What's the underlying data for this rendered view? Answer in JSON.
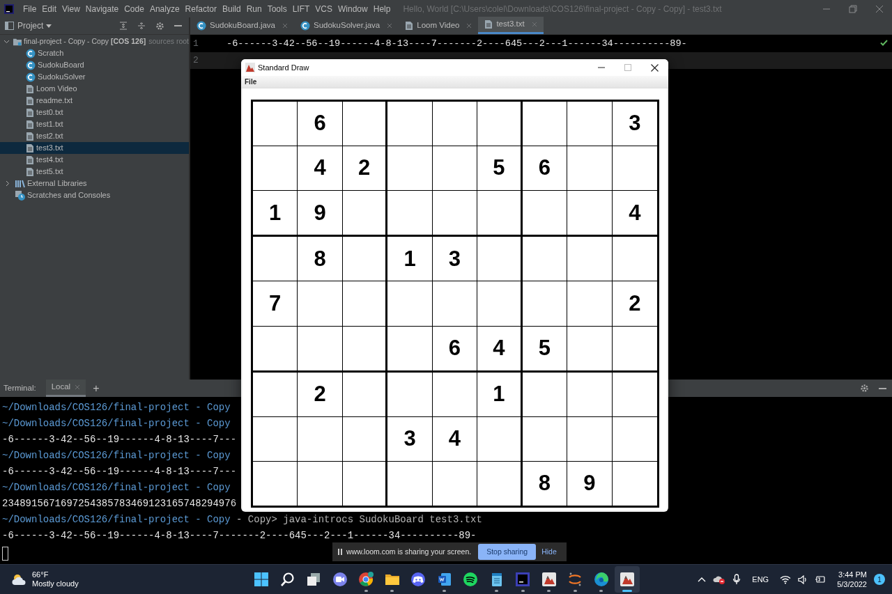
{
  "ide": {
    "menu": [
      "File",
      "Edit",
      "View",
      "Navigate",
      "Code",
      "Analyze",
      "Refactor",
      "Build",
      "Run",
      "Tools",
      "LIFT",
      "VCS",
      "Window",
      "Help"
    ],
    "title": "Hello, World [C:\\Users\\colel\\Downloads\\COS126\\final-project - Copy - Copy] - test3.txt",
    "project_panel": {
      "title": "Project",
      "root": {
        "label": "final-project - Copy - Copy",
        "module": "[COS 126]",
        "note": "sources root",
        "expanded": true,
        "children": [
          {
            "label": "Scratch",
            "kind": "class",
            "selected": false
          },
          {
            "label": "SudokuBoard",
            "kind": "class",
            "selected": false
          },
          {
            "label": "SudokuSolver",
            "kind": "class",
            "selected": false
          },
          {
            "label": "Loom Video",
            "kind": "file",
            "selected": false
          },
          {
            "label": "readme.txt",
            "kind": "file",
            "selected": false
          },
          {
            "label": "test0.txt",
            "kind": "file",
            "selected": false
          },
          {
            "label": "test1.txt",
            "kind": "file",
            "selected": false
          },
          {
            "label": "test2.txt",
            "kind": "file",
            "selected": false
          },
          {
            "label": "test3.txt",
            "kind": "file",
            "selected": true
          },
          {
            "label": "test4.txt",
            "kind": "file",
            "selected": false
          },
          {
            "label": "test5.txt",
            "kind": "file",
            "selected": false
          }
        ]
      },
      "others": [
        {
          "label": "External Libraries",
          "kind": "libraries",
          "expanded": false
        },
        {
          "label": "Scratches and Consoles",
          "kind": "scratches"
        }
      ]
    },
    "editor_tabs": [
      {
        "label": "SudokuBoard.java",
        "kind": "class",
        "selected": false
      },
      {
        "label": "SudokuSolver.java",
        "kind": "class",
        "selected": false
      },
      {
        "label": "Loom Video",
        "kind": "file",
        "selected": false
      },
      {
        "label": "test3.txt",
        "kind": "file",
        "selected": true
      }
    ],
    "editor_lines": [
      {
        "number": "1",
        "text": "-6------3-42--56--19------4-8-13----7-------2----645---2---1------34----------89-",
        "current": false
      },
      {
        "number": "2",
        "current": true
      }
    ],
    "terminal": {
      "title": "Terminal:",
      "tabs": [
        {
          "label": "Local",
          "selected": true
        }
      ],
      "new_tab": "+",
      "lines": [
        {
          "kind": "prompt",
          "text": "~/Downloads/COS126/final-project - Copy"
        },
        {
          "kind": "prompt",
          "text": "~/Downloads/COS126/final-project - Copy"
        },
        {
          "kind": "output",
          "text": "-6------3-42--56--19------4-8-13----7---"
        },
        {
          "kind": "prompt",
          "text": "~/Downloads/COS126/final-project - Copy"
        },
        {
          "kind": "output",
          "text": "-6------3-42--56--19------4-8-13----7---"
        },
        {
          "kind": "prompt",
          "text": "~/Downloads/COS126/final-project - Copy"
        },
        {
          "kind": "output",
          "text": "2348915671697254385783469123165748294976"
        },
        {
          "kind": "prompt",
          "text": "~/Downloads/COS126/final-project - Copy",
          "command": "- Copy> java-introcs SudokuBoard test3.txt"
        },
        {
          "kind": "output",
          "text": "-6------3-42--56--19------4-8-13----7-------2----645---2---1------34----------89-"
        },
        {
          "kind": "cursor"
        }
      ]
    }
  },
  "draw_window": {
    "title": "Standard Draw",
    "menu": [
      "File"
    ],
    "grid": [
      [
        {
          "kind": "blank"
        },
        {
          "kind": "digit",
          "digit": "6"
        },
        {
          "kind": "blank"
        },
        {
          "kind": "blank"
        },
        {
          "kind": "blank"
        },
        {
          "kind": "blank"
        },
        {
          "kind": "blank"
        },
        {
          "kind": "blank"
        },
        {
          "kind": "digit",
          "digit": "3"
        }
      ],
      [
        {
          "kind": "blank"
        },
        {
          "kind": "digit",
          "digit": "4"
        },
        {
          "kind": "digit",
          "digit": "2"
        },
        {
          "kind": "blank"
        },
        {
          "kind": "blank"
        },
        {
          "kind": "digit",
          "digit": "5"
        },
        {
          "kind": "digit",
          "digit": "6"
        },
        {
          "kind": "blank"
        },
        {
          "kind": "blank"
        }
      ],
      [
        {
          "kind": "digit",
          "digit": "1"
        },
        {
          "kind": "digit",
          "digit": "9"
        },
        {
          "kind": "blank"
        },
        {
          "kind": "blank"
        },
        {
          "kind": "blank"
        },
        {
          "kind": "blank"
        },
        {
          "kind": "blank"
        },
        {
          "kind": "blank"
        },
        {
          "kind": "digit",
          "digit": "4"
        }
      ],
      [
        {
          "kind": "blank"
        },
        {
          "kind": "digit",
          "digit": "8"
        },
        {
          "kind": "blank"
        },
        {
          "kind": "digit",
          "digit": "1"
        },
        {
          "kind": "digit",
          "digit": "3"
        },
        {
          "kind": "blank"
        },
        {
          "kind": "blank"
        },
        {
          "kind": "blank"
        },
        {
          "kind": "blank"
        }
      ],
      [
        {
          "kind": "digit",
          "digit": "7"
        },
        {
          "kind": "blank"
        },
        {
          "kind": "blank"
        },
        {
          "kind": "blank"
        },
        {
          "kind": "blank"
        },
        {
          "kind": "blank"
        },
        {
          "kind": "blank"
        },
        {
          "kind": "blank"
        },
        {
          "kind": "digit",
          "digit": "2"
        }
      ],
      [
        {
          "kind": "blank"
        },
        {
          "kind": "blank"
        },
        {
          "kind": "blank"
        },
        {
          "kind": "blank"
        },
        {
          "kind": "digit",
          "digit": "6"
        },
        {
          "kind": "digit",
          "digit": "4"
        },
        {
          "kind": "digit",
          "digit": "5"
        },
        {
          "kind": "blank"
        },
        {
          "kind": "blank"
        }
      ],
      [
        {
          "kind": "blank"
        },
        {
          "kind": "digit",
          "digit": "2"
        },
        {
          "kind": "blank"
        },
        {
          "kind": "blank"
        },
        {
          "kind": "blank"
        },
        {
          "kind": "digit",
          "digit": "1"
        },
        {
          "kind": "blank"
        },
        {
          "kind": "blank"
        },
        {
          "kind": "blank"
        }
      ],
      [
        {
          "kind": "blank"
        },
        {
          "kind": "blank"
        },
        {
          "kind": "blank"
        },
        {
          "kind": "digit",
          "digit": "3"
        },
        {
          "kind": "digit",
          "digit": "4"
        },
        {
          "kind": "blank"
        },
        {
          "kind": "blank"
        },
        {
          "kind": "blank"
        },
        {
          "kind": "blank"
        }
      ],
      [
        {
          "kind": "blank"
        },
        {
          "kind": "blank"
        },
        {
          "kind": "blank"
        },
        {
          "kind": "blank"
        },
        {
          "kind": "blank"
        },
        {
          "kind": "blank"
        },
        {
          "kind": "digit",
          "digit": "8"
        },
        {
          "kind": "digit",
          "digit": "9"
        },
        {
          "kind": "blank"
        }
      ]
    ]
  },
  "loom_bar": {
    "message": "www.loom.com is sharing your screen.",
    "buttons": [
      "Stop sharing",
      "Hide"
    ]
  },
  "taskbar": {
    "weather": {
      "temperature": "66°F",
      "summary": "Mostly cloudy"
    },
    "apps": [
      {
        "kind": "start",
        "running": false,
        "selected": false
      },
      {
        "kind": "search",
        "running": false,
        "selected": false
      },
      {
        "kind": "taskview",
        "running": false,
        "selected": false
      },
      {
        "kind": "chat",
        "running": false,
        "selected": false
      },
      {
        "kind": "browser",
        "running": true,
        "selected": false
      },
      {
        "kind": "folder",
        "running": true,
        "selected": false
      },
      {
        "kind": "gamepad",
        "running": false,
        "selected": false
      },
      {
        "kind": "document",
        "running": true,
        "selected": false
      },
      {
        "kind": "music",
        "running": false,
        "selected": false
      },
      {
        "kind": "notepad",
        "running": true,
        "selected": false
      },
      {
        "kind": "ide",
        "running": true,
        "selected": false
      },
      {
        "kind": "java",
        "running": true,
        "selected": false
      },
      {
        "kind": "orbit",
        "running": true,
        "selected": false
      },
      {
        "kind": "edge",
        "running": true,
        "selected": false
      },
      {
        "kind": "java",
        "running": true,
        "selected": true
      }
    ],
    "tray": {
      "language": "ENG",
      "time": "3:44 PM",
      "date": "5/3/2022",
      "notifications": "1"
    }
  }
}
